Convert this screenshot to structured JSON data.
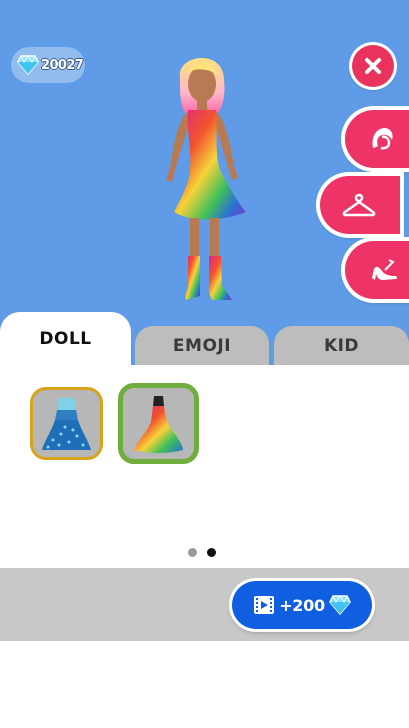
{
  "hud": {
    "gem_count": "20027"
  },
  "side_tabs": [
    {
      "icon": "hair-icon",
      "selected": false
    },
    {
      "icon": "hanger-icon",
      "selected": true
    },
    {
      "icon": "high-heel-icon",
      "selected": false
    }
  ],
  "category_tabs": [
    {
      "label": "DOLL",
      "selected": true
    },
    {
      "label": "EMOJI",
      "selected": false
    },
    {
      "label": "KID",
      "selected": false
    }
  ],
  "items": [
    {
      "icon": "blue-sequin-dress-icon",
      "highlight": "#d9a319"
    },
    {
      "icon": "tie-dye-dress-icon",
      "highlight": "#6fad3d",
      "selected": true
    }
  ],
  "pagination": {
    "current": 2,
    "total": 2
  },
  "reward_button": {
    "label": "+200",
    "icon": "video-ad-icon"
  },
  "colors": {
    "sky": "#5f9be6",
    "accent_pink": "#ee3466",
    "reward_blue": "#0f5fe0"
  }
}
